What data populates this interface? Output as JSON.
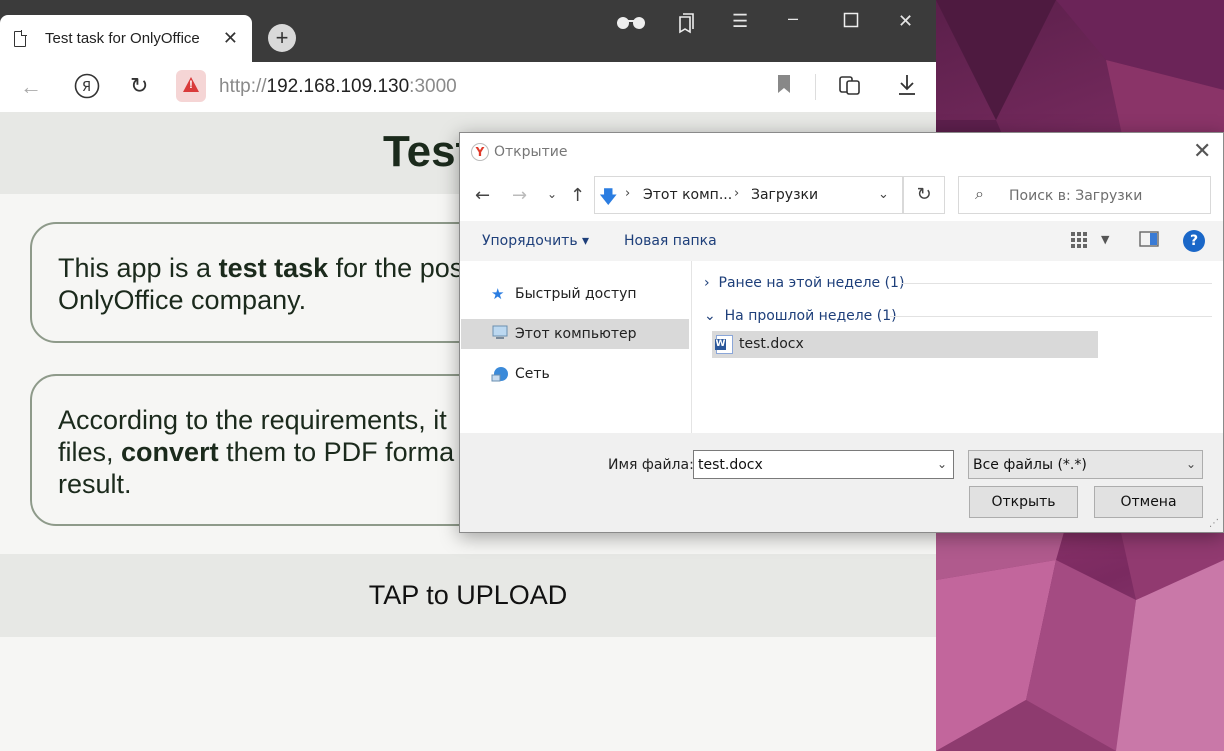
{
  "browser": {
    "tab_title": "Test task for OnlyOffice",
    "tab_close": "✕",
    "new_tab": "+",
    "url_scheme": "http://",
    "url_host": "192.168.109.130",
    "url_port": ":3000"
  },
  "page": {
    "title": "Test",
    "card1_a": "This app is a ",
    "card1_b": "test task",
    "card1_c": " for the pos",
    "card1_d": "OnlyOffice company.",
    "card2_a": "According to the requirements, it",
    "card2_b": "files, ",
    "card2_c": "convert",
    "card2_d": " them to PDF forma",
    "card2_e": "result.",
    "upload": "TAP to UPLOAD"
  },
  "dialog": {
    "title": "Открытие",
    "crumb1": "Этот комп...",
    "crumb2": "Загрузки",
    "search_placeholder": "Поиск в: Загрузки",
    "organize": "Упорядочить ▾",
    "new_folder": "Новая папка",
    "sidebar": [
      {
        "label": "Быстрый доступ",
        "icon": "star-icon"
      },
      {
        "label": "Этот компьютер",
        "icon": "computer-icon"
      },
      {
        "label": "Сеть",
        "icon": "network-icon"
      }
    ],
    "group1": "Ранее на этой неделе (1)",
    "group2": "На прошлой неделе (1)",
    "file_name": "test.docx",
    "filename_label": "Имя файла:",
    "filename_value": "test.docx",
    "filetype_value": "Все файлы (*.*)",
    "open_button": "Открыть",
    "cancel_button": "Отмена"
  },
  "colors": {
    "accent": "#1e3f7a",
    "tabbar": "#3b3b3b",
    "wallpaper": "#7d2d63"
  }
}
